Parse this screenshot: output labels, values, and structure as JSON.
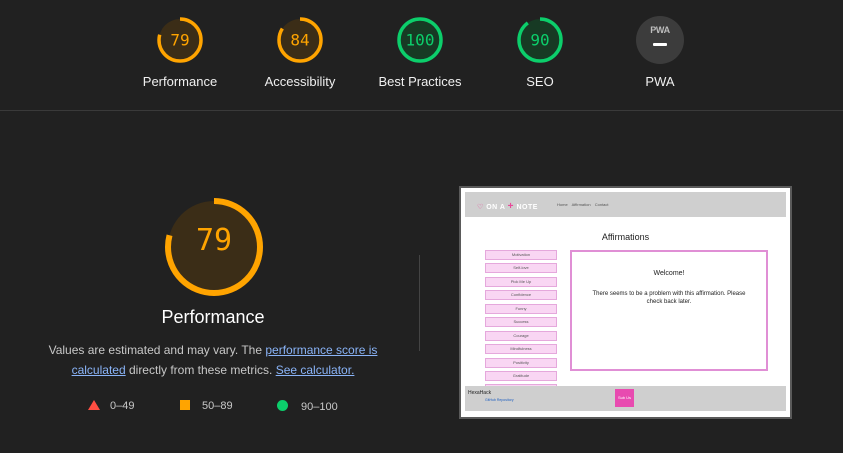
{
  "colors": {
    "average": "#ffa400",
    "pass": "#0cce6b",
    "fail": "#ff4e42",
    "average_bg": "#3b2d17",
    "pass_bg": "#173a24"
  },
  "categories": [
    {
      "label": "Performance",
      "score": "79",
      "value": 79,
      "rating": "average"
    },
    {
      "label": "Accessibility",
      "score": "84",
      "value": 84,
      "rating": "average"
    },
    {
      "label": "Best Practices",
      "score": "100",
      "value": 100,
      "rating": "pass"
    },
    {
      "label": "SEO",
      "score": "90",
      "value": 90,
      "rating": "pass"
    },
    {
      "label": "PWA",
      "badge_text": "PWA"
    }
  ],
  "main": {
    "score": "79",
    "value": 79,
    "title": "Performance",
    "desc_prefix": "Values are estimated and may vary. The ",
    "desc_link1": "performance score is calculated",
    "desc_middle": " directly from these metrics. ",
    "desc_link2": "See calculator."
  },
  "legend": {
    "fail": "0–49",
    "average": "50–89",
    "pass": "90–100"
  },
  "thumbnail": {
    "logo_left": "ON A",
    "logo_right": "NOTE",
    "nav_links": [
      "Home",
      "Affirmation",
      "Contact"
    ],
    "heading": "Affirmations",
    "buttons": [
      "Motivation",
      "Self-love",
      "Pick Me Up",
      "Confidence",
      "Funny",
      "Success",
      "Courage",
      "Mindfulness",
      "Positivity",
      "Gratitude",
      "Peace"
    ],
    "card_title": "Welcome!",
    "card_message": "There seems to be a problem with this affirmation. Please check back later.",
    "footer_name": "HexaHack",
    "footer_repo": "GitHub Repository",
    "footer_button": "Sub Us"
  }
}
